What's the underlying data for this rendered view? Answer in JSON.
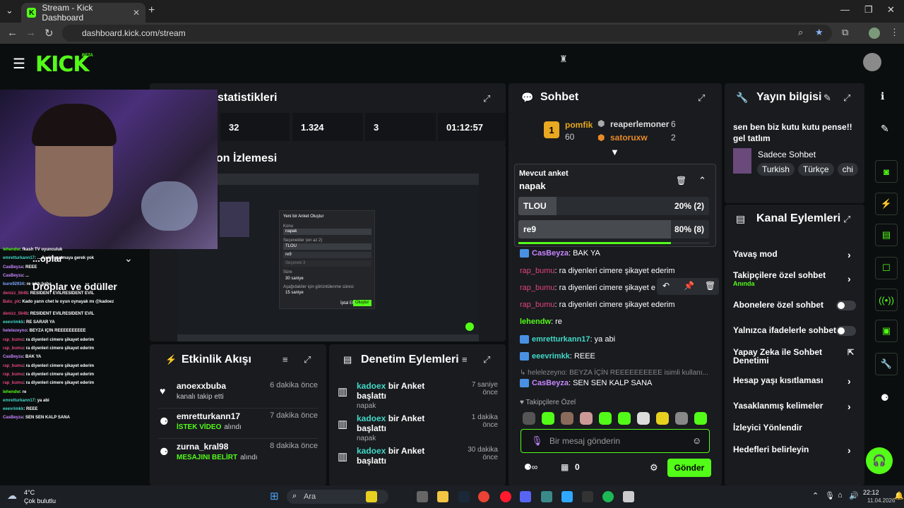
{
  "browser": {
    "tab_title": "Stream - Kick Dashboard",
    "url": "dashboard.kick.com/stream"
  },
  "header": {
    "logo": "KICK",
    "logo_badge": "BETA"
  },
  "stats": {
    "title": "statistikleri",
    "values": [
      "32",
      "1.324",
      "3",
      "01:12:57"
    ]
  },
  "stream_preview": {
    "title": "on İzlemesi"
  },
  "webcam_overlay": {
    "chat_lines": [
      {
        "user": "lehendw",
        "text": ": fkash TV oyunculuk"
      },
      {
        "user": "emretturkann17",
        "text": ": ... il win uzatmaya gerek yok"
      },
      {
        "user": "CasBeyza",
        "text": ": REEE"
      },
      {
        "user": "CasBeyza",
        "text": ": ..."
      },
      {
        "user": "buro92934",
        "text": ": re sıktı baba"
      },
      {
        "user": "denizz_5648",
        "text": ": RESİDENT EVİLRESİDENT EVİL"
      },
      {
        "user": "Batu_pk",
        "text": ": Kado yarın chet le oyun oynayak mı @kadoez"
      },
      {
        "user": "denizz_5648",
        "text": ": RESİDENT EVİLRESİDENT EVİL"
      },
      {
        "user": "eeevrimkk",
        "text": ": RE SARAR YA"
      },
      {
        "user": "helelezeyno",
        "text": ": BEYZA İÇİN REEEEEEEEEE"
      },
      {
        "user": "rap_bumu",
        "text": ": ra diyenleri cimere şikayet ederim"
      },
      {
        "user": "rap_bumu",
        "text": ": ra diyenleri cimere şikayet ederim"
      },
      {
        "user": "CasBeyza",
        "text": ": BAK YA"
      },
      {
        "user": "rap_bumu",
        "text": ": ra diyenleri cimere şikayet ederim"
      },
      {
        "user": "rap_bumu",
        "text": ": ra diyenleri cimere şikayet ederim"
      },
      {
        "user": "rap_bumu",
        "text": ": ra diyenleri cimere şikayet ederim"
      },
      {
        "user": "lehendw",
        "text": ": re"
      },
      {
        "user": "emretturkann17",
        "text": ": ya abi"
      },
      {
        "user": "eeevrimkk",
        "text": ": REEE"
      },
      {
        "user": "CasBeyza",
        "text": ": SEN SEN KALP SANA"
      }
    ],
    "sidebar_label1": "...oplar",
    "sidebar_label2": "Droplar ve ödüller"
  },
  "poll_dialog": {
    "title": "Yeni bir Anket Oluştur",
    "topic_label": "Konu",
    "topic_value": "napak",
    "options_label": "Seçenekler (en az 2)",
    "option1": "TLOU",
    "option2": "re9",
    "option3_placeholder": "Seçenek 3",
    "duration_label": "Süre",
    "duration_value": "30 saniye",
    "results_label": "Aşağıdakiler için görüntülenme süresi",
    "results_value": "15 saniye",
    "cancel": "İptal Et",
    "submit": "Oluştur"
  },
  "activity": {
    "title": "Etkinlik Akışı",
    "items": [
      {
        "name": "anoexxbuba",
        "detail": "kanalı takip etti",
        "highlight": "",
        "time": "6 dakika önce"
      },
      {
        "name": "emretturkann17",
        "detail": "alındı",
        "highlight": "İSTEK VİDEO",
        "time": "7 dakika önce"
      },
      {
        "name": "zurna_kral98",
        "detail": "alındı",
        "highlight": "MESAJINI BELİRT",
        "time": "8 dakika önce"
      }
    ]
  },
  "moderation": {
    "title": "Denetim Eylemleri",
    "items": [
      {
        "user": "kadoex",
        "action": "bir Anket başlattı",
        "topic": "napak",
        "time": "7 saniye önce"
      },
      {
        "user": "kadoex",
        "action": "bir Anket başlattı",
        "topic": "napak",
        "time": "1 dakika önce"
      },
      {
        "user": "kadoex",
        "action": "bir Anket başlattı",
        "topic": "",
        "time": "30 dakika önce"
      }
    ]
  },
  "chat": {
    "title": "Sohbet",
    "leaderboard": {
      "first_name": "pomfik",
      "first_points": "60",
      "others": [
        {
          "name": "reaperlemoner",
          "points": "6"
        },
        {
          "name": "satoruxw",
          "points": "2"
        }
      ]
    },
    "poll": {
      "label": "Mevcut anket",
      "question": "napak",
      "options": [
        {
          "label": "TLOU",
          "result": "20% (2)",
          "pct": 20
        },
        {
          "label": "re9",
          "result": "80% (8)",
          "pct": 80
        }
      ],
      "progress": 0.8
    },
    "messages": [
      {
        "user": "CasBeyza",
        "text": ": BAK YA",
        "color": "violet",
        "badge": true
      },
      {
        "user": "rap_bumu",
        "text": ": ra diyenleri cimere şikayet ederim",
        "color": "pink",
        "badge": false
      },
      {
        "user": "rap_bumu",
        "text": ": ra diyenleri cimere şikayet e",
        "color": "pink",
        "badge": false
      },
      {
        "user": "rap_bumu",
        "text": ": ra diyenleri cimere şikayet ederim",
        "color": "pink",
        "badge": false
      },
      {
        "user": "lehendw",
        "text": ": re",
        "color": "green",
        "badge": false
      },
      {
        "user": "emretturkann17",
        "text": ": ya abi",
        "color": "cyan",
        "badge": true
      },
      {
        "user": "eeevrimkk",
        "text": ": REEE",
        "color": "cyan",
        "badge": true
      },
      {
        "user": "CasBeyza",
        "text": ": SEN SEN KALP SANA",
        "color": "violet",
        "badge": true
      }
    ],
    "reply_preview": "helelezeyno: BEYZA İÇİN REEEEEEEEEE isimli kullanı...",
    "followers_only": "Takipçilere Özel",
    "input_placeholder": "Bir mesaj gönderin",
    "count": "0",
    "send": "Gönder"
  },
  "stream_info": {
    "title": "Yayın bilgisi",
    "stream_title": "sen ben biz kutu kutu pense!! gel tatlım",
    "category": "Sadece Sohbet",
    "tags": [
      "Turkish",
      "Türkçe",
      "chi"
    ]
  },
  "channel_actions": {
    "title": "Kanal Eylemleri",
    "items": [
      {
        "label": "Yavaş mod",
        "sub": "",
        "control": "chevron"
      },
      {
        "label": "Takipçilere özel sohbet",
        "sub": "Anında",
        "control": "chevron"
      },
      {
        "label": "Abonelere özel sohbet",
        "sub": "",
        "control": "toggle"
      },
      {
        "label": "Yalnızca ifadelerle sohbet",
        "sub": "",
        "control": "toggle"
      },
      {
        "label": "Yapay Zeka ile Sohbet Denetimi",
        "sub": "",
        "control": "external"
      },
      {
        "label": "Hesap yaşı kısıtlaması",
        "sub": "",
        "control": "chevron"
      },
      {
        "label": "Yasaklanmış kelimeler",
        "sub": "",
        "control": "chevron"
      },
      {
        "label": "İzleyici Yönlendir",
        "sub": "",
        "control": ""
      },
      {
        "label": "Hedefleri belirleyin",
        "sub": "",
        "control": "chevron"
      }
    ]
  },
  "taskbar": {
    "weather_temp": "4°C",
    "weather_desc": "Çok bulutlu",
    "search": "Ara",
    "time": "22:12",
    "date": "11.04.2026"
  },
  "colors": {
    "accent": "#53fc18",
    "panel": "#191b1f",
    "bg": "#0b0e0f"
  }
}
